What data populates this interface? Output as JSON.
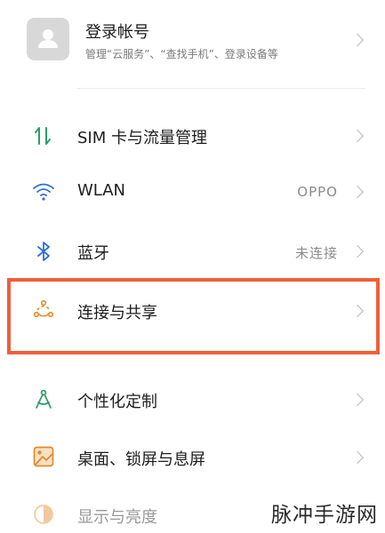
{
  "account": {
    "title": "登录帐号",
    "subtitle": "管理“云服务”、“查找手机”、登录设备等"
  },
  "items": [
    {
      "label": "SIM 卡与流量管理",
      "value": "",
      "icon": "sim-data-icon"
    },
    {
      "label": "WLAN",
      "value": "OPPO",
      "icon": "wifi-icon"
    },
    {
      "label": "蓝牙",
      "value": "未连接",
      "icon": "bluetooth-icon"
    },
    {
      "label": "连接与共享",
      "value": "",
      "icon": "connection-share-icon",
      "highlighted": true
    },
    {
      "label": "个性化定制",
      "value": "",
      "icon": "personalization-icon"
    },
    {
      "label": "桌面、锁屏与息屏",
      "value": "",
      "icon": "wallpaper-icon"
    },
    {
      "label": "显示与亮度",
      "value": "",
      "icon": "brightness-icon"
    }
  ],
  "watermark": "脉冲手游网",
  "colors": {
    "highlight_border": "#f05f3a",
    "icon_green": "#2e9d6a",
    "icon_blue": "#2f6fd6",
    "icon_orange": "#e48a2a"
  }
}
